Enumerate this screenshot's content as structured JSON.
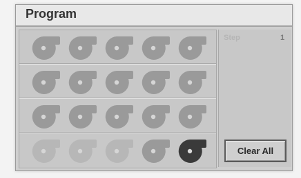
{
  "title": "Program",
  "step": {
    "label": "Step",
    "value": "1"
  },
  "clear_button": {
    "label": "Clear All"
  },
  "pads": [
    [
      {
        "icon": "fan-icon",
        "state": "inactive"
      },
      {
        "icon": "fan-icon",
        "state": "inactive"
      },
      {
        "icon": "fan-icon",
        "state": "inactive"
      },
      {
        "icon": "fan-icon",
        "state": "inactive"
      },
      {
        "icon": "fan-icon",
        "state": "inactive"
      }
    ],
    [
      {
        "icon": "fan-icon",
        "state": "inactive"
      },
      {
        "icon": "fan-icon",
        "state": "inactive"
      },
      {
        "icon": "fan-icon",
        "state": "inactive"
      },
      {
        "icon": "fan-icon",
        "state": "inactive"
      },
      {
        "icon": "fan-icon",
        "state": "inactive"
      }
    ],
    [
      {
        "icon": "fan-icon",
        "state": "inactive"
      },
      {
        "icon": "fan-icon",
        "state": "inactive"
      },
      {
        "icon": "fan-icon",
        "state": "inactive"
      },
      {
        "icon": "fan-icon",
        "state": "inactive"
      },
      {
        "icon": "fan-icon",
        "state": "inactive"
      }
    ],
    [
      {
        "icon": "fan-icon",
        "state": "faded"
      },
      {
        "icon": "fan-icon",
        "state": "faded"
      },
      {
        "icon": "fan-icon",
        "state": "faded"
      },
      {
        "icon": "fan-icon",
        "state": "inactive"
      },
      {
        "icon": "fan-icon",
        "state": "active"
      }
    ]
  ],
  "colors": {
    "icon_active": "#3a3a3a",
    "icon_inactive": "#9a9a9a",
    "icon_faded": "#b7b7b7"
  }
}
